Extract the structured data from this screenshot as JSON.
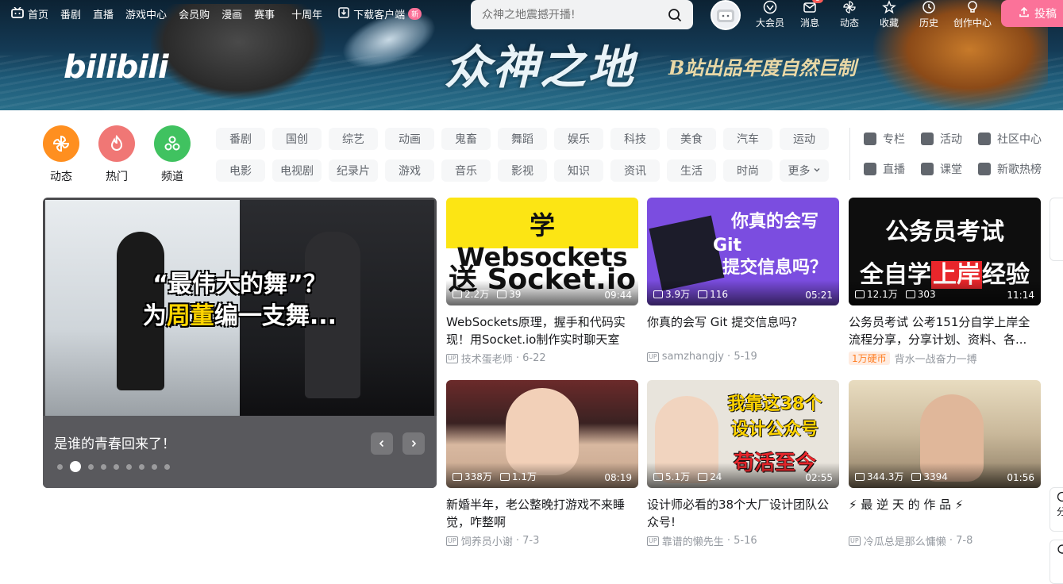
{
  "nav": {
    "items": [
      "首页",
      "番剧",
      "直播",
      "游戏中心",
      "会员购",
      "漫画",
      "赛事",
      "十周年"
    ],
    "download": "下载客户端",
    "download_badge": "新"
  },
  "search": {
    "placeholder": "众神之地震撼开播!"
  },
  "right_nav": {
    "items": [
      "大会员",
      "消息",
      "动态",
      "收藏",
      "历史",
      "创作中心"
    ],
    "msg_badge": "8",
    "upload": "投稿"
  },
  "banner": {
    "logo": "bilibili",
    "title": "众神之地",
    "subtitle": "B站出品年度自然巨制"
  },
  "channels": [
    {
      "label": "动态",
      "color": "#ff8f1f"
    },
    {
      "label": "热门",
      "color": "#f07775"
    },
    {
      "label": "频道",
      "color": "#40c260"
    }
  ],
  "tags": [
    "番剧",
    "国创",
    "综艺",
    "动画",
    "鬼畜",
    "舞蹈",
    "娱乐",
    "科技",
    "美食",
    "汽车",
    "运动",
    "电影",
    "电视剧",
    "纪录片",
    "游戏",
    "音乐",
    "影视",
    "知识",
    "资讯",
    "生活",
    "时尚",
    "更多"
  ],
  "side_links": [
    "专栏",
    "活动",
    "社区中心",
    "直播",
    "课堂",
    "新歌热榜"
  ],
  "carousel": {
    "headline_1": "“最伟大的舞”？",
    "headline_2_pre": "为",
    "headline_2_hl": "周董",
    "headline_2_post": "编一支舞...",
    "title": "是谁的青春回来了！"
  },
  "videos": [
    {
      "thumb_text_1": "学 Websockets",
      "thumb_text_2": "送 Socket.io",
      "views": "2.2万",
      "danmaku": "39",
      "duration": "09:44",
      "title": "WebSockets原理，握手和代码实现！用Socket.io制作实时聊天室",
      "author": "技术蛋老师",
      "date": "6-22",
      "coin": ""
    },
    {
      "thumb_text_1": "你真的会写",
      "thumb_text_2": "Git",
      "thumb_text_3": "提交信息吗？",
      "views": "3.9万",
      "danmaku": "116",
      "duration": "05:21",
      "title": "你真的会写 Git 提交信息吗?",
      "author": "samzhangjy",
      "date": "5-19",
      "coin": ""
    },
    {
      "thumb_text_1": "公务员考试",
      "thumb_text_2": "全自学",
      "thumb_text_hl": "上岸",
      "thumb_text_3": "经验",
      "views": "12.1万",
      "danmaku": "303",
      "duration": "11:14",
      "title": "公务员考试 公考151分自学上岸全流程分享，分享计划、资料、各...",
      "author": "背水一战奋力一搏",
      "date": "",
      "coin": "1万硬币"
    },
    {
      "views": "338万",
      "danmaku": "1.1万",
      "duration": "08:19",
      "title": "新婚半年，老公整晚打游戏不来睡觉，咋整啊",
      "author": "饲养员小谢",
      "date": "7-3",
      "coin": ""
    },
    {
      "thumb_text_1": "我靠这38个",
      "thumb_text_2": "设计公众号",
      "thumb_text_3": "苟活至今",
      "views": "5.1万",
      "danmaku": "24",
      "duration": "02:55",
      "title": "设计师必看的38个大厂设计团队公众号!",
      "author": "靠谱的懒先生",
      "date": "5-16",
      "coin": ""
    },
    {
      "views": "344.3万",
      "danmaku": "3394",
      "duration": "01:56",
      "title": "⚡ 最 逆 天 的 作 品 ⚡",
      "author": "冷瓜总是那么慵懒",
      "date": "7-8",
      "coin": ""
    }
  ],
  "edge": {
    "btn1": "分",
    "btn2": ""
  }
}
